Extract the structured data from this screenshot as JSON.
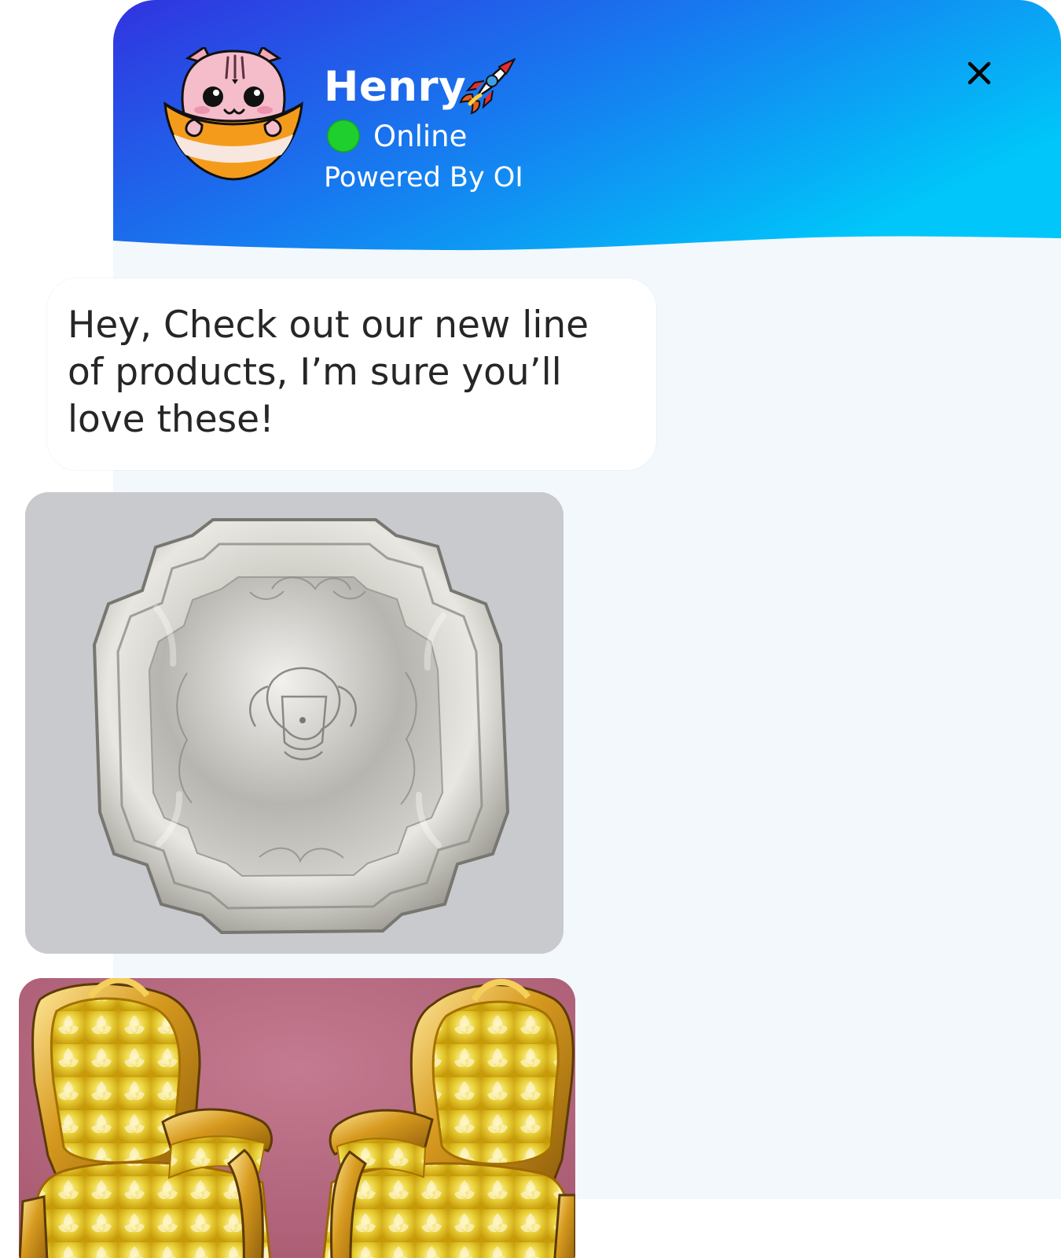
{
  "header": {
    "agent_name": "Henry",
    "status": "Online",
    "powered_by": "Powered By OI",
    "close_icon": "close-icon",
    "rocket_icon": "rocket-icon",
    "avatar_icon": "cat-in-bowl-avatar"
  },
  "message": {
    "text": "Hey, Check out our new line\nof products, I’m sure you’ll\nlove these!"
  },
  "products": [
    {
      "image": "silver-tray-image"
    },
    {
      "image": "gilded-armchairs-image"
    }
  ],
  "colors": {
    "header_gradient_start": "#3133df",
    "header_gradient_mid": "#167cf0",
    "header_gradient_end": "#00c6f9",
    "chat_background": "#f3f8fd",
    "bubble_background": "#ffffff",
    "status_online": "#1fcf2e",
    "message_text": "#262626"
  }
}
